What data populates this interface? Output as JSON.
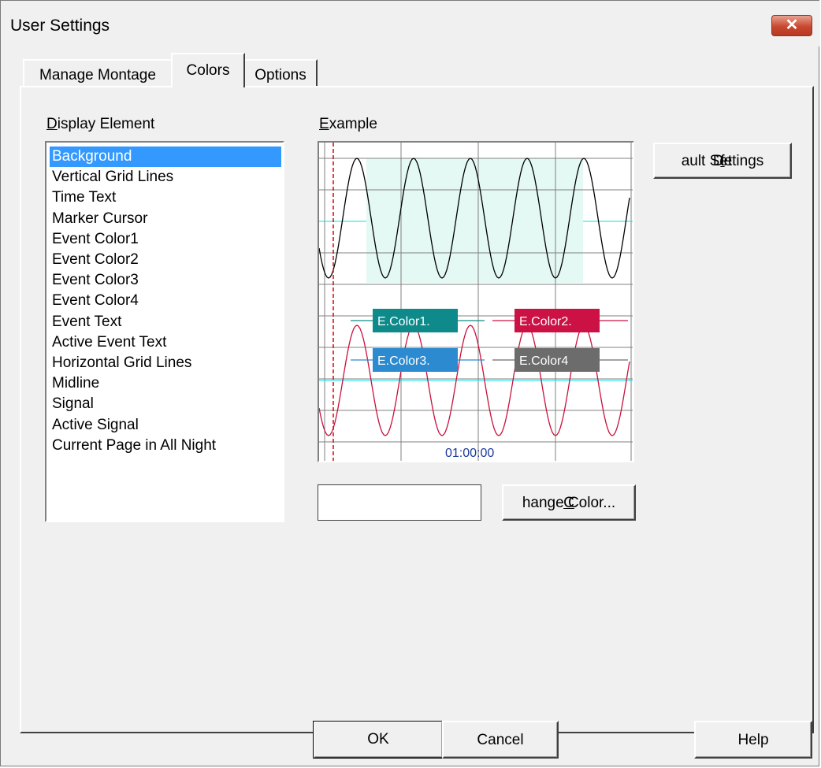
{
  "window": {
    "title": "User Settings",
    "close_glyph": "✕"
  },
  "tabs": [
    {
      "label": "Manage Montage",
      "active": false
    },
    {
      "label": "Colors",
      "active": true
    },
    {
      "label": "Options",
      "active": false
    }
  ],
  "display_element": {
    "label": "Display Element",
    "accel": "D",
    "label_rest": "isplay Element",
    "selected": "Background",
    "items": [
      "Background",
      "Vertical Grid Lines",
      "Time Text",
      "Marker Cursor",
      "Event Color1",
      "Event Color2",
      "Event Color3",
      "Event Color4",
      "Event Text",
      "Active Event Text",
      "Horizontal Grid Lines",
      "Midline",
      "Signal",
      "Active Signal",
      "Current Page in All Night"
    ]
  },
  "example": {
    "label": "Example",
    "accel": "E",
    "label_rest": "xample",
    "events": [
      {
        "label": "E.Color1.",
        "color": "#0e8a8a"
      },
      {
        "label": "E.Color2.",
        "color": "#cc1144"
      },
      {
        "label": "E.Color3.",
        "color": "#2b8ad0"
      },
      {
        "label": "E.Color4",
        "color": "#6c6c6c"
      }
    ],
    "time_text": "01:00:00",
    "colors": {
      "grid": "#808080",
      "midline": "#00e5ee",
      "signal": "#000000",
      "active_signal": "#c8103c",
      "marker_cursor": "#e00000",
      "page_highlight": "#e4f8f4",
      "time_text": "#1a3a9a"
    }
  },
  "buttons": {
    "default_settings": {
      "pre": "De",
      "accel": "f",
      "post": "ault Settings"
    },
    "change_color": {
      "accel": "C",
      "rest": "hange Color..."
    },
    "ok": "OK",
    "cancel": "Cancel",
    "help": "Help"
  },
  "selection_color": "#3399ff"
}
